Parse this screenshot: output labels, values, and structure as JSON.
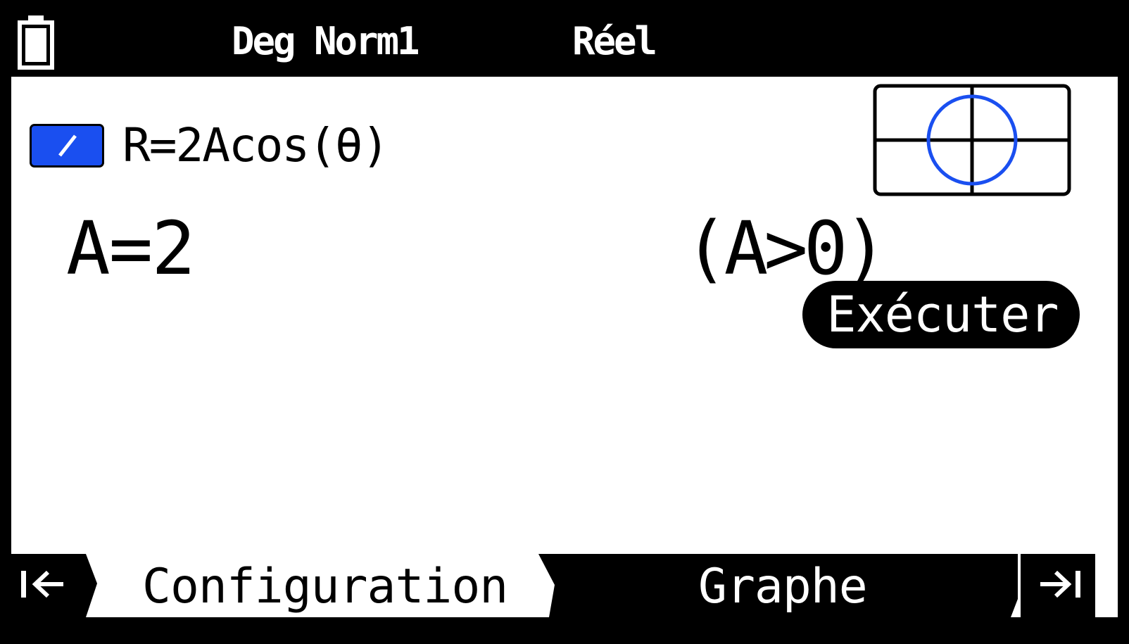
{
  "status_bar": {
    "angle_unit": "Deg",
    "display_format": "Norm1",
    "complex_mode": "Réel",
    "battery_icon": "battery-icon"
  },
  "equation": {
    "enabled": true,
    "text": "R=2Acos(θ)",
    "line_color": "#1a4ff0"
  },
  "parameter": {
    "value_text": "A=2",
    "condition_text": "(A>0)"
  },
  "execute_button": {
    "label": "Exécuter"
  },
  "graph_preview": {
    "curve_color": "#1a4ff0",
    "icon": "polar-circle-graph-icon"
  },
  "tabs": {
    "prev_icon": "arrow-left-to-bar-icon",
    "next_icon": "arrow-right-to-bar-icon",
    "items": [
      {
        "label": "Configuration",
        "active": true
      },
      {
        "label": "Graphe",
        "active": false
      }
    ]
  }
}
